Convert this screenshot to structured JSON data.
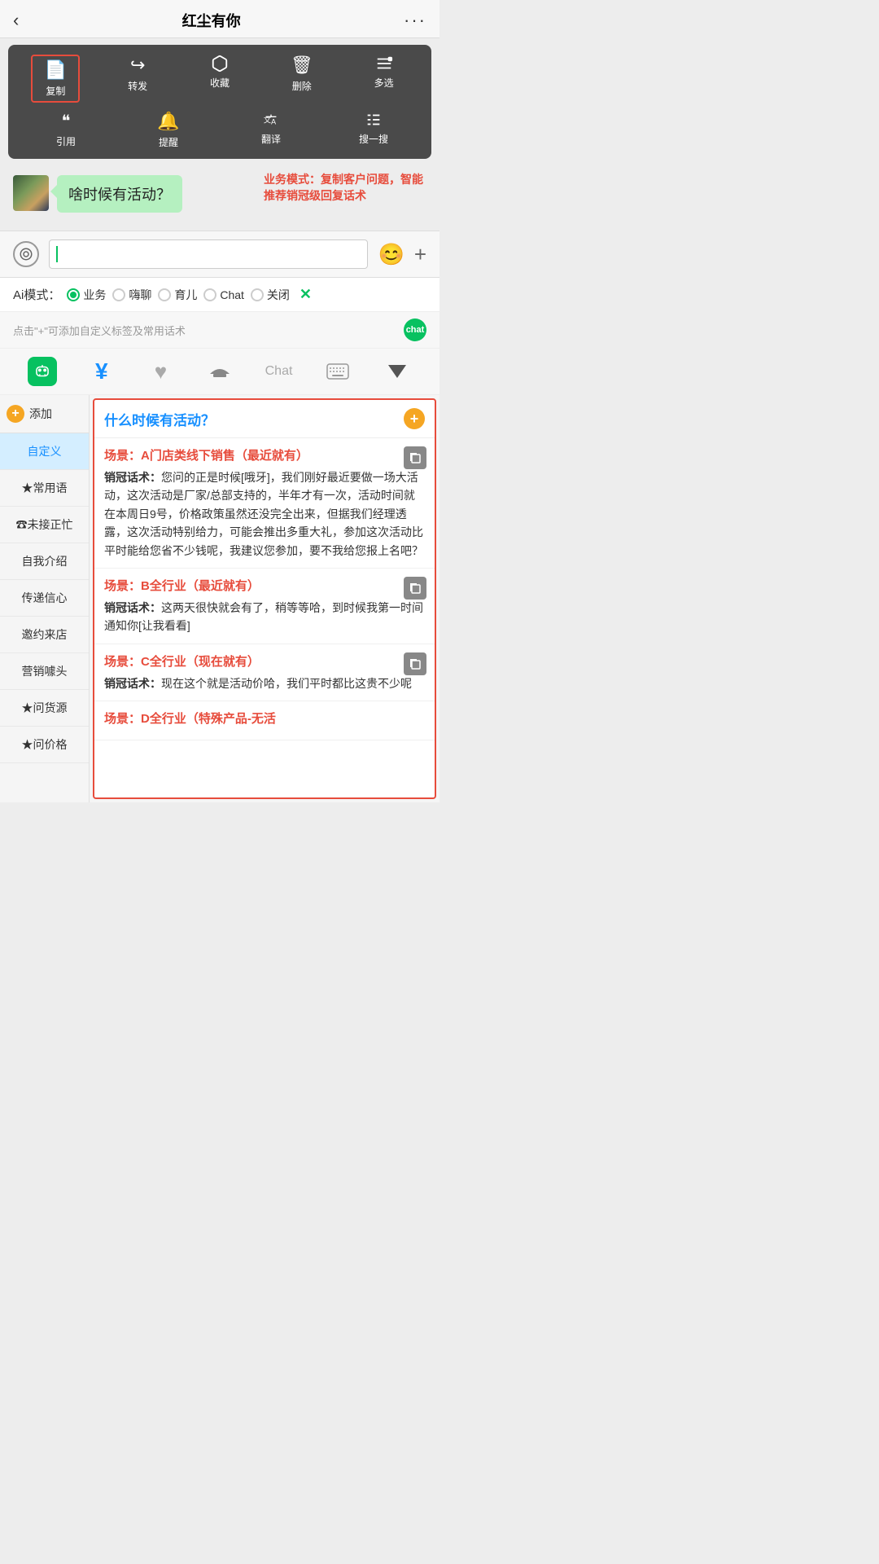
{
  "header": {
    "back_label": "‹",
    "title": "红尘有你",
    "more_label": "···"
  },
  "context_menu": {
    "row1": [
      {
        "id": "copy",
        "icon": "📄",
        "label": "复制"
      },
      {
        "id": "forward",
        "icon": "↪",
        "label": "转发"
      },
      {
        "id": "favorite",
        "icon": "⬡",
        "label": "收藏"
      },
      {
        "id": "delete",
        "icon": "🗑",
        "label": "删除"
      },
      {
        "id": "multiselect",
        "icon": "☰",
        "label": "多选"
      }
    ],
    "row2": [
      {
        "id": "quote",
        "icon": "❝",
        "label": "引用"
      },
      {
        "id": "remind",
        "icon": "🔔",
        "label": "提醒"
      },
      {
        "id": "translate",
        "icon": "⇄",
        "label": "翻译"
      },
      {
        "id": "search",
        "icon": "✳",
        "label": "搜一搜"
      }
    ]
  },
  "chat": {
    "bubble_text": "啥时候有活动？",
    "annotation": "业务模式：复制客户问题，智能推荐销冠级回复话术"
  },
  "input": {
    "placeholder": "",
    "voice_icon": "◉",
    "emoji_label": "😊",
    "plus_label": "+"
  },
  "ai_modes": {
    "label": "Ai模式：",
    "options": [
      {
        "id": "business",
        "label": "业务",
        "active": true
      },
      {
        "id": "chat",
        "label": "嗨聊",
        "active": false
      },
      {
        "id": "parenting",
        "label": "育儿",
        "active": false
      },
      {
        "id": "chat2",
        "label": "Chat",
        "active": false
      },
      {
        "id": "off",
        "label": "关闭",
        "active": false
      }
    ],
    "close_label": "✕"
  },
  "hint_bar": {
    "text": "点击\"+\"可添加自定义标签及常用话术"
  },
  "toolbar": {
    "items": [
      {
        "id": "bot",
        "label": "🤖",
        "active": true
      },
      {
        "id": "money",
        "label": "¥",
        "active": false
      },
      {
        "id": "heart",
        "label": "♥",
        "active": false
      },
      {
        "id": "hat",
        "label": "🎓",
        "active": false
      },
      {
        "id": "chat",
        "label": "Chat",
        "active": false
      },
      {
        "id": "keyboard",
        "label": "⌨",
        "active": false
      }
    ]
  },
  "sidebar": {
    "add_label": "添加",
    "items": [
      {
        "id": "custom",
        "label": "自定义",
        "active": true
      },
      {
        "id": "common",
        "label": "★常用语",
        "active": false
      },
      {
        "id": "busy",
        "label": "☎未接正忙",
        "active": false
      },
      {
        "id": "intro",
        "label": "自我介绍",
        "active": false
      },
      {
        "id": "trust",
        "label": "传递信心",
        "active": false
      },
      {
        "id": "invite",
        "label": "邀约来店",
        "active": false
      },
      {
        "id": "marketing",
        "label": "营销噱头",
        "active": false
      },
      {
        "id": "source",
        "label": "★问货源",
        "active": false
      },
      {
        "id": "price",
        "label": "★问价格",
        "active": false
      }
    ]
  },
  "scripts": {
    "question": "什么时候有活动？",
    "blocks": [
      {
        "id": "scene-a",
        "scene": "场景：A门店类线下销售（最近就有）",
        "content": "销冠话术：您问的正是时候[哦牙]，我们刚好最近要做一场大活动，这次活动是厂家/总部支持的，半年才有一次，活动时间就在本周日9号，价格政策虽然还没完全出来，但据我们经理透露，这次活动特别给力，可能会推出多重大礼，参加这次活动比平时能给您省不少钱呢，我建议您参加，要不我给您报上名吧？"
      },
      {
        "id": "scene-b",
        "scene": "场景：B全行业（最近就有）",
        "content": "销冠话术：这两天很快就会有了，稍等等哈，到时候我第一时间通知你[让我看看]"
      },
      {
        "id": "scene-c",
        "scene": "场景：C全行业（现在就有）",
        "content": "销冠话术：现在这个就是活动价哈，我们平时都比这贵不少呢"
      },
      {
        "id": "scene-d",
        "scene": "场景：D全行业（特殊产品-无活",
        "content": ""
      }
    ]
  }
}
